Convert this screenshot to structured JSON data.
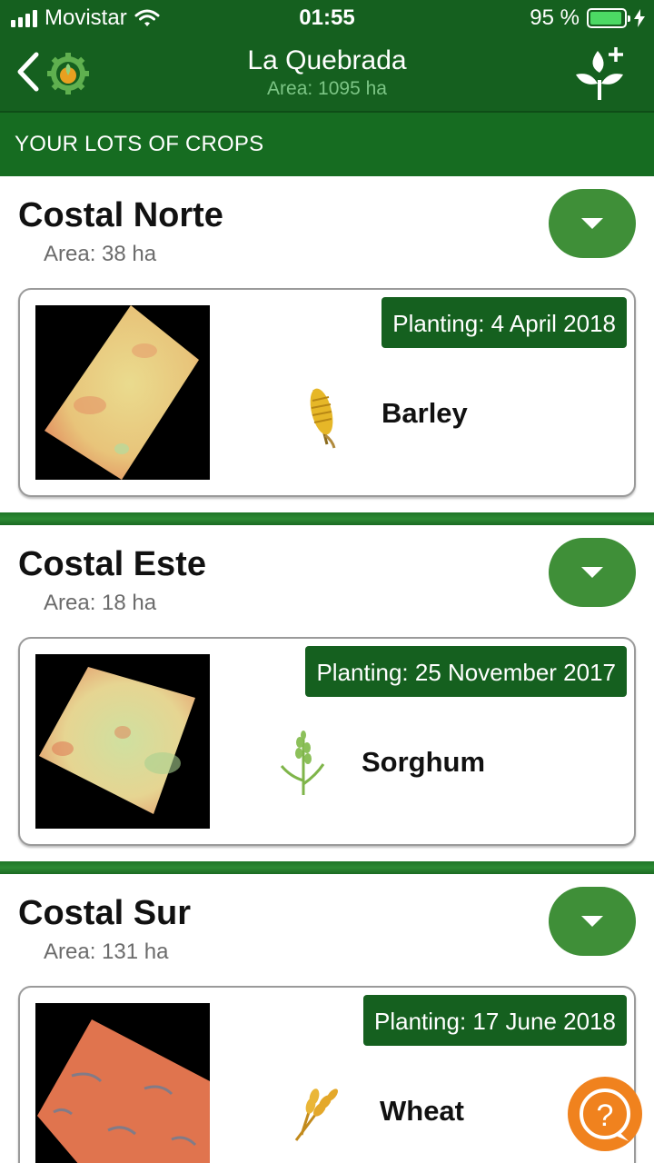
{
  "status_bar": {
    "carrier": "Movistar",
    "time": "01:55",
    "battery_percent": "95 %",
    "battery_level": 0.95,
    "icons": [
      "signal-icon",
      "wifi-icon",
      "battery-icon",
      "charging-icon"
    ]
  },
  "header": {
    "title": "La Quebrada",
    "subtitle": "Area: 1095 ha",
    "icons": [
      "back-chevron-icon",
      "app-logo-icon",
      "add-plant-icon"
    ]
  },
  "section_title": "YOUR LOTS OF CROPS",
  "lots": [
    {
      "name": "Costal Norte",
      "area": "Area: 38 ha",
      "planting": "Planting: 4 April 2018",
      "crop": "Barley",
      "crop_icon": "barley-icon"
    },
    {
      "name": "Costal Este",
      "area": "Area: 18 ha",
      "planting": "Planting: 25 November 2017",
      "crop": "Sorghum",
      "crop_icon": "sorghum-icon"
    },
    {
      "name": "Costal Sur",
      "area": "Area: 131 ha",
      "planting": "Planting: 17 June 2018",
      "crop": "Wheat",
      "crop_icon": "wheat-icon"
    }
  ],
  "colors": {
    "primary_dark": "#15601f",
    "accent_green": "#3f8f38",
    "help_orange": "#f0821e"
  }
}
